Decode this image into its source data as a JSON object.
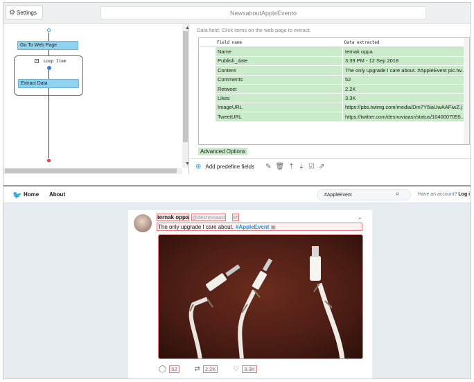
{
  "settings": {
    "label": "Settings"
  },
  "task_title": "NewsaboutAppleEvento",
  "workflow": {
    "goto_label": "Go To Web Page",
    "loop_label": "Loop Item",
    "extract_label": "Extract Data"
  },
  "data_panel": {
    "hint": "Data field: Click items on the web page to extract.",
    "headers": [
      "Field name",
      "Data extracted"
    ],
    "rows": [
      [
        "Name",
        "ternak oppa"
      ],
      [
        "Publish_date",
        "3:39 PM - 12 Sep 2018"
      ],
      [
        "Content",
        "The only upgrade I care about. #AppleEvent pic.tw..."
      ],
      [
        "Comments",
        "52"
      ],
      [
        "Retweet",
        "2.2K"
      ],
      [
        "Likes",
        "3.3K"
      ],
      [
        "ImageURL",
        "https://pbs.twimg.com/media/Dm7Y5iaUwAAFiwZ.j"
      ],
      [
        "TweetURL",
        "https://twitter.com/desnoviaasr/status/1040007055..."
      ]
    ],
    "advanced_label": "Advanced Options",
    "add_fields_label": "Add predefine fields"
  },
  "twitter": {
    "home_label": "Home",
    "about_label": "About",
    "search_value": "#AppleEvent",
    "account_text": "Have an account?",
    "login_text": "Log i",
    "tweet": {
      "name": "ternak oppa",
      "handle": "@desnoviaasr",
      "time": "8h",
      "text": "The only upgrade I care about.",
      "hashtag": "#AppleEvent",
      "comments": "52",
      "retweets": "2.2K",
      "likes": "3.3K"
    }
  },
  "icons": [
    "gear-icon",
    "chevron-up-icon",
    "chevron-down-icon",
    "plus-circle-icon",
    "edit-icon",
    "trash-icon",
    "sort-asc-icon",
    "sort-desc-icon",
    "check-square-icon",
    "export-icon",
    "twitter-bird-icon",
    "search-icon",
    "reply-icon",
    "retweet-icon",
    "heart-icon"
  ]
}
